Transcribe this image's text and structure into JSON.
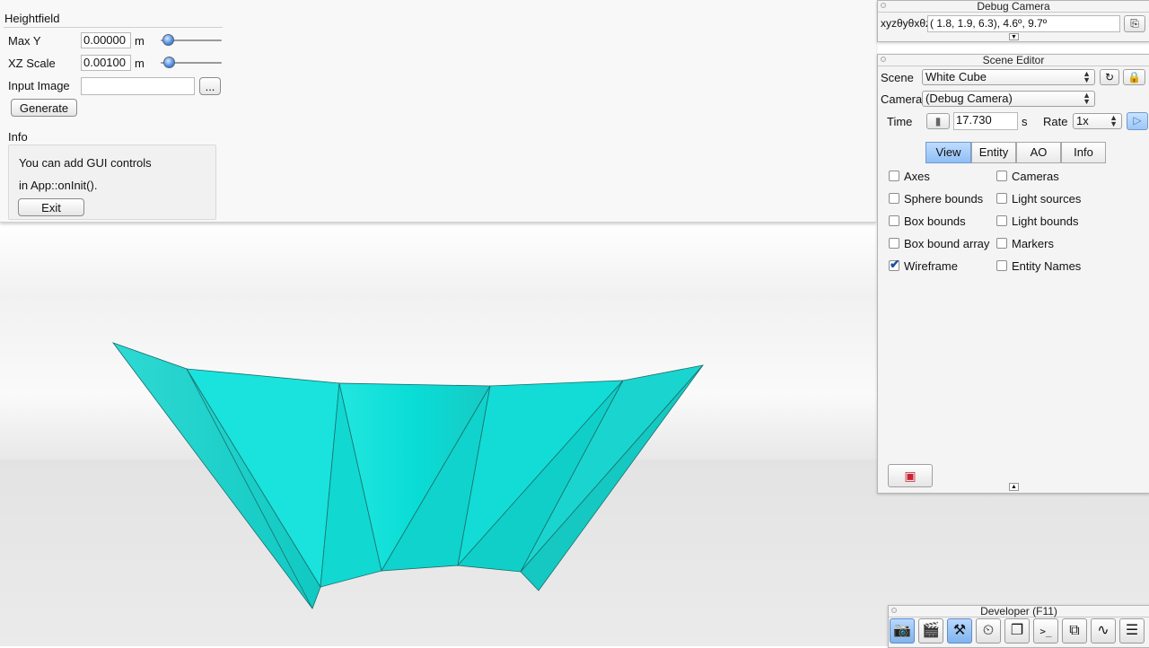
{
  "heightfield": {
    "title": "Heightfield",
    "max_y": {
      "label": "Max Y",
      "value": "0.00000",
      "unit": "m"
    },
    "xz_scale": {
      "label": "XZ Scale",
      "value": "0.00100",
      "unit": "m"
    },
    "input_image": {
      "label": "Input Image",
      "value": "",
      "browse_label": "..."
    },
    "generate_label": "Generate"
  },
  "info": {
    "title": "Info",
    "line1": "You can add GUI controls",
    "line2": "in App::onInit().",
    "exit_label": "Exit"
  },
  "debug_camera": {
    "title": "Debug Camera",
    "prefix": "xyzθyθxθz",
    "value": "(   1.8,    1.9,    6.3),    4.6º,    9.7º"
  },
  "scene_editor": {
    "title": "Scene Editor",
    "scene_label": "Scene",
    "scene_value": "White Cube",
    "camera_label": "Camera",
    "camera_value": "(Debug Camera)",
    "time_label": "Time",
    "time_value": "17.730",
    "time_unit": "s",
    "rate_label": "Rate",
    "rate_value": "1x",
    "tabs": [
      "View",
      "Entity",
      "AO",
      "Info"
    ],
    "active_tab": "View",
    "checkboxes_left": [
      {
        "label": "Axes",
        "checked": false
      },
      {
        "label": "Sphere bounds",
        "checked": false
      },
      {
        "label": "Box bounds",
        "checked": false
      },
      {
        "label": "Box bound array",
        "checked": false
      },
      {
        "label": "Wireframe",
        "checked": true
      }
    ],
    "checkboxes_right": [
      {
        "label": "Cameras",
        "checked": false
      },
      {
        "label": "Light sources",
        "checked": false
      },
      {
        "label": "Light bounds",
        "checked": false
      },
      {
        "label": "Markers",
        "checked": false
      },
      {
        "label": "Entity Names",
        "checked": false
      }
    ]
  },
  "developer": {
    "title": "Developer (F11)"
  },
  "colors": {
    "mesh": "#12e4dc",
    "accent": "#8ebff5"
  }
}
